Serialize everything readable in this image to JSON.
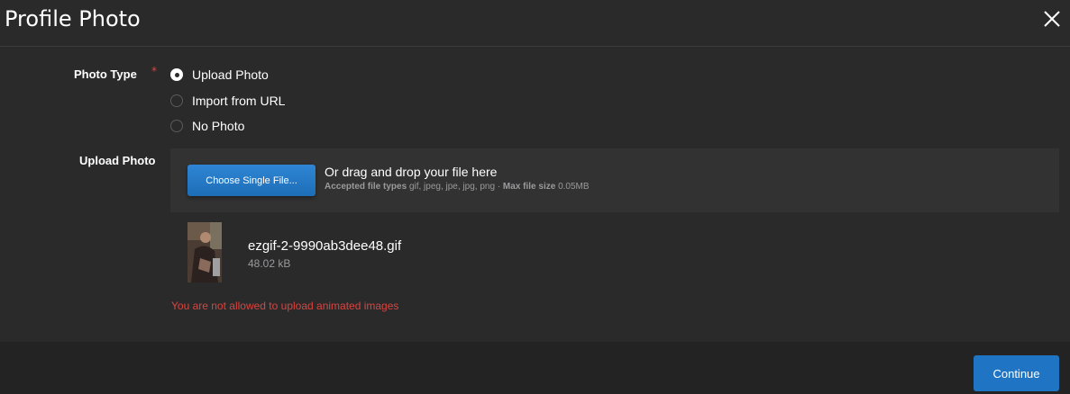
{
  "dialog": {
    "title": "Profile Photo"
  },
  "photo_type": {
    "label": "Photo Type",
    "required_mark": "*",
    "options": [
      {
        "label": "Upload Photo",
        "checked": true
      },
      {
        "label": "Import from URL",
        "checked": false
      },
      {
        "label": "No Photo",
        "checked": false
      }
    ]
  },
  "upload": {
    "label": "Upload Photo",
    "choose_button": "Choose Single File...",
    "drag_text": "Or drag and drop your file here",
    "accepted_label": "Accepted file types",
    "accepted_types": "gif, jpeg, jpe, jpg, png",
    "separator": "·",
    "max_size_label": "Max file size",
    "max_size": "0.05MB"
  },
  "file": {
    "name": "ezgif-2-9990ab3dee48.gif",
    "size": "48.02 kB"
  },
  "error": "You are not allowed to upload animated images",
  "footer": {
    "continue": "Continue"
  },
  "colors": {
    "background": "#2a2a2b",
    "dropzone": "#323233",
    "accent": "#1f74c4",
    "error": "#d9443f",
    "required": "#e0443e"
  }
}
